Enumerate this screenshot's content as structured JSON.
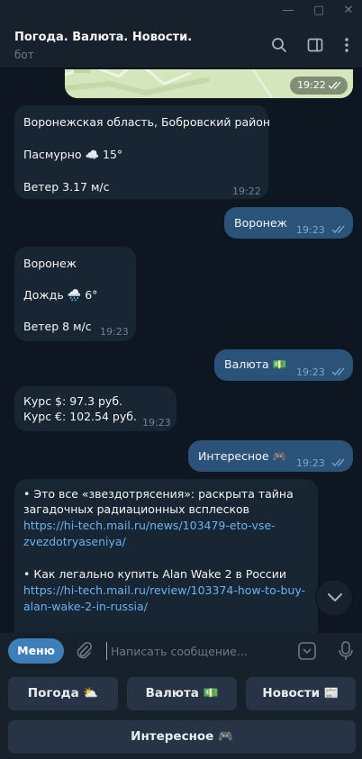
{
  "window": {
    "minimize": "—",
    "maximize": "▢",
    "close": "✕"
  },
  "header": {
    "title": "Погода. Валюта. Новости.",
    "subtitle": "бот"
  },
  "messages": [
    {
      "type": "map",
      "time": "19:22"
    },
    {
      "type": "in",
      "lines": [
        "Воронежская область, Бобровский район",
        "Пасмурно  ☁️  15°",
        "Ветер  3.17 м/с"
      ],
      "time": "19:22"
    },
    {
      "type": "out",
      "text": "Воронеж",
      "time": "19:23"
    },
    {
      "type": "in",
      "lines": [
        "Воронеж",
        "Дождь  🌧️  6°",
        "Ветер  8 м/с"
      ],
      "time": "19:23"
    },
    {
      "type": "out",
      "text": "Валюта 💵",
      "time": "19:23"
    },
    {
      "type": "in",
      "lines": [
        "Курс $:   97.3 руб.",
        "Курс €:   102.54 руб."
      ],
      "time": "19:23"
    },
    {
      "type": "out",
      "text": "Интересное 🎮",
      "time": "19:23"
    },
    {
      "type": "in",
      "lines": [
        "• Это все «звездотрясения»: раскрыта тайна",
        "загадочных радиационных всплесков",
        "https://hi-tech.mail.ru/news/103479-eto-vse-",
        "zvezdotryaseniya/",
        "• Как легально купить Alan Wake 2 в России",
        "https://hi-tech.mail.ru/review/103374-how-to-buy-",
        "alan-wake-2-in-russia/"
      ]
    }
  ],
  "composer": {
    "menu_label": "Меню",
    "placeholder": "Написать сообщение..."
  },
  "keyboard": {
    "row1": [
      "Погода ⛅",
      "Валюта 💵",
      "Новости 📰"
    ],
    "row2": [
      "Интересное 🎮"
    ]
  },
  "colors": {
    "background": "#0e1621",
    "panel": "#17212b",
    "incoming": "#182533",
    "outgoing": "#2b5278",
    "accent": "#3e7fb9",
    "link": "#6ab3f3"
  },
  "icons": [
    "search-icon",
    "sidebar-toggle-icon",
    "more-vertical-icon",
    "double-check-icon",
    "chevron-down-icon",
    "attach-icon",
    "emoji-icon",
    "microphone-icon"
  ]
}
